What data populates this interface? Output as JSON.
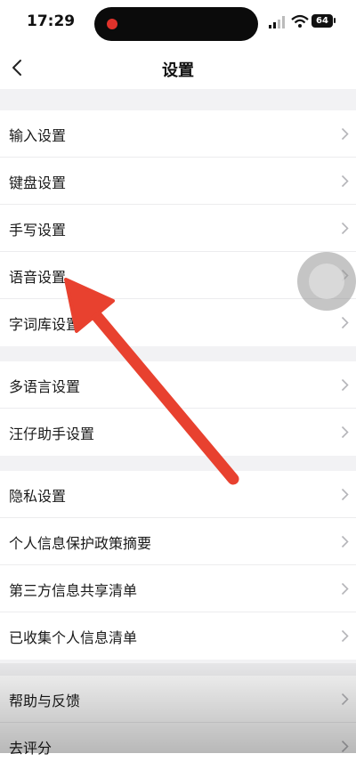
{
  "status": {
    "time": "17:29",
    "battery": "64"
  },
  "nav": {
    "title": "设置",
    "back_icon": "chevron-left-icon"
  },
  "groups": [
    {
      "items": [
        {
          "label": "输入设置"
        },
        {
          "label": "键盘设置"
        },
        {
          "label": "手写设置"
        },
        {
          "label": "语音设置"
        },
        {
          "label": "字词库设置"
        }
      ]
    },
    {
      "items": [
        {
          "label": "多语言设置"
        },
        {
          "label": "汪仔助手设置"
        }
      ]
    },
    {
      "items": [
        {
          "label": "隐私设置"
        },
        {
          "label": "个人信息保护政策摘要"
        },
        {
          "label": "第三方信息共享清单"
        },
        {
          "label": "已收集个人信息清单"
        }
      ]
    },
    {
      "items": [
        {
          "label": "帮助与反馈"
        },
        {
          "label": "去评分"
        }
      ]
    }
  ],
  "colors": {
    "background": "#f2f2f4",
    "accent_arrow": "#e8412f",
    "recording_dot": "#e0322b"
  }
}
